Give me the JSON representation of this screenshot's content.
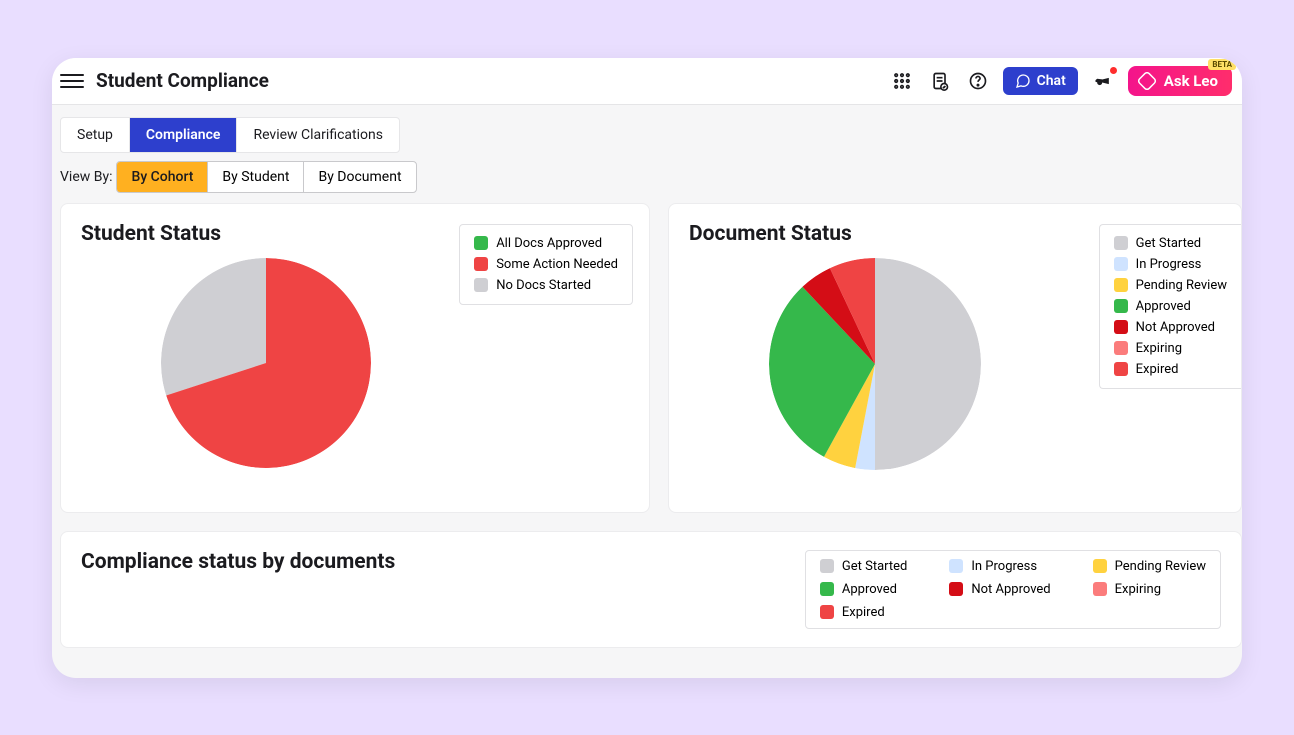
{
  "header": {
    "title": "Student Compliance",
    "chat_label": "Chat",
    "leo_label": "Ask Leo",
    "leo_badge": "BETA"
  },
  "tabs": {
    "items": [
      "Setup",
      "Compliance",
      "Review Clarifications"
    ],
    "active_index": 1
  },
  "viewby": {
    "label": "View By:",
    "options": [
      "By Cohort",
      "By Student",
      "By Document"
    ],
    "active_index": 0
  },
  "student_status": {
    "title": "Student Status",
    "legend": [
      {
        "label": "All Docs Approved",
        "color": "#35b84b"
      },
      {
        "label": "Some Action Needed",
        "color": "#ef4444"
      },
      {
        "label": "No Docs Started",
        "color": "#cfcfd3"
      }
    ]
  },
  "document_status": {
    "title": "Document Status",
    "legend": [
      {
        "label": "Get Started",
        "color": "#cfcfd3"
      },
      {
        "label": "In Progress",
        "color": "#cfe3ff"
      },
      {
        "label": "Pending Review",
        "color": "#ffd23f"
      },
      {
        "label": "Approved",
        "color": "#35b84b"
      },
      {
        "label": "Not Approved",
        "color": "#d40d16"
      },
      {
        "label": "Expiring",
        "color": "#fb7c7c"
      },
      {
        "label": "Expired",
        "color": "#ef4444"
      }
    ]
  },
  "compliance_table": {
    "title": "Compliance status by documents",
    "legend": [
      {
        "label": "Get Started",
        "color": "#cfcfd3"
      },
      {
        "label": "In Progress",
        "color": "#cfe3ff"
      },
      {
        "label": "Pending Review",
        "color": "#ffd23f"
      },
      {
        "label": "Approved",
        "color": "#35b84b"
      },
      {
        "label": "Not Approved",
        "color": "#d40d16"
      },
      {
        "label": "Expiring",
        "color": "#fb7c7c"
      },
      {
        "label": "Expired",
        "color": "#ef4444"
      }
    ]
  },
  "chart_data": [
    {
      "type": "pie",
      "title": "Student Status",
      "series": [
        {
          "name": "Some Action Needed",
          "value": 70,
          "color": "#ef4444"
        },
        {
          "name": "No Docs Started",
          "value": 30,
          "color": "#cfcfd3"
        },
        {
          "name": "All Docs Approved",
          "value": 0,
          "color": "#35b84b"
        }
      ]
    },
    {
      "type": "pie",
      "title": "Document Status",
      "series": [
        {
          "name": "Get Started",
          "value": 50,
          "color": "#cfcfd3"
        },
        {
          "name": "In Progress",
          "value": 3,
          "color": "#cfe3ff"
        },
        {
          "name": "Pending Review",
          "value": 5,
          "color": "#ffd23f"
        },
        {
          "name": "Approved",
          "value": 30,
          "color": "#35b84b"
        },
        {
          "name": "Not Approved",
          "value": 5,
          "color": "#d40d16"
        },
        {
          "name": "Expired",
          "value": 7,
          "color": "#ef4444"
        },
        {
          "name": "Expiring",
          "value": 0,
          "color": "#fb7c7c"
        }
      ]
    }
  ]
}
